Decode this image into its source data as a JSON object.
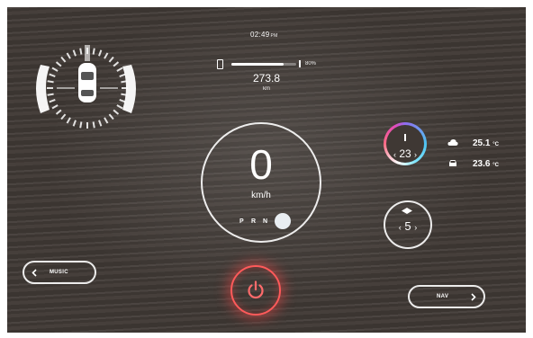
{
  "status": {
    "clock": "02:49",
    "clock_suffix": "PM",
    "battery_percent_label": "80%",
    "range_value": "273.8",
    "range_unit": "km",
    "range_level": 0.8
  },
  "speed": {
    "value": "0",
    "unit": "km/h",
    "gears": [
      "P",
      "R",
      "N"
    ],
    "selected_gear": "D"
  },
  "climate": {
    "set_temperature": "23",
    "outside_temperature": "25.1",
    "inside_temperature": "23.6",
    "temp_unit": "°C",
    "fan_speed": "5",
    "arrow_left": "‹",
    "arrow_right": "›"
  },
  "buttons": {
    "music_label": "MUSIC",
    "nav_label": "NAV"
  },
  "icons": {
    "vehicle": "car-top-view-icon",
    "battery": "battery-icon",
    "power": "power-icon",
    "outside": "cloud-icon",
    "inside": "car-icon",
    "fan": "fan-icon"
  },
  "colors": {
    "power_glow": "#ff5a5a",
    "climate_gradient": [
      "#8f6cf0",
      "#4ec3f0",
      "#ffffff",
      "#ff6b84",
      "#e24ab8"
    ]
  }
}
